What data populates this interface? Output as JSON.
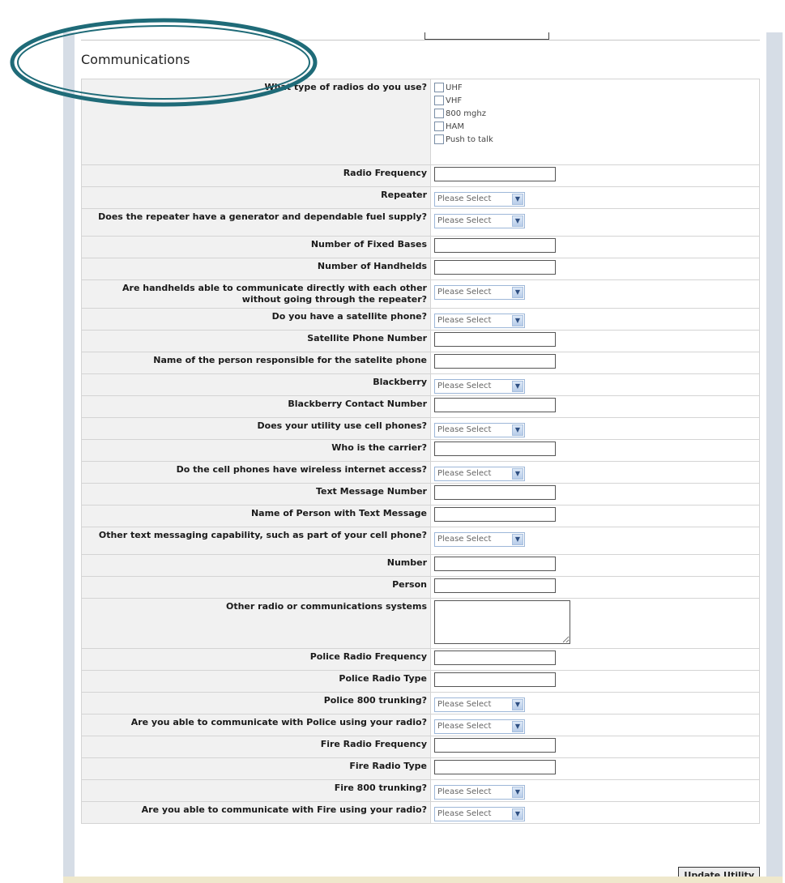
{
  "section": {
    "title": "Communications"
  },
  "rows": [
    {
      "label": "What type of radios do you use?",
      "type": "checkboxes",
      "options": [
        "UHF",
        "VHF",
        "800 mghz",
        "HAM",
        "Push to talk"
      ]
    },
    {
      "label": "Radio Frequency",
      "type": "text",
      "value": ""
    },
    {
      "label": "Repeater",
      "type": "select",
      "value": "Please Select"
    },
    {
      "label": "Does the repeater have a generator and dependable fuel supply?",
      "type": "select",
      "value": "Please Select"
    },
    {
      "label": "Number of Fixed Bases",
      "type": "text",
      "value": ""
    },
    {
      "label": "Number of Handhelds",
      "type": "text",
      "value": ""
    },
    {
      "label": "Are handhelds able to communicate directly with each other without going through the repeater?",
      "type": "select",
      "value": "Please Select"
    },
    {
      "label": "Do you have a satellite phone?",
      "type": "select",
      "value": "Please Select"
    },
    {
      "label": "Satellite Phone Number",
      "type": "text",
      "value": ""
    },
    {
      "label": "Name of the person responsible for the satelite phone",
      "type": "text",
      "value": ""
    },
    {
      "label": "Blackberry",
      "type": "select",
      "value": "Please Select"
    },
    {
      "label": "Blackberry Contact Number",
      "type": "text",
      "value": ""
    },
    {
      "label": "Does your utility use cell phones?",
      "type": "select",
      "value": "Please Select"
    },
    {
      "label": "Who is the carrier?",
      "type": "text",
      "value": ""
    },
    {
      "label": "Do the cell phones have wireless internet access?",
      "type": "select",
      "value": "Please Select"
    },
    {
      "label": "Text Message Number",
      "type": "text",
      "value": ""
    },
    {
      "label": "Name of Person with Text Message",
      "type": "text",
      "value": ""
    },
    {
      "label": "Other text messaging capability, such as part of your cell phone?",
      "type": "select",
      "value": "Please Select"
    },
    {
      "label": "Number",
      "type": "text",
      "value": ""
    },
    {
      "label": "Person",
      "type": "text",
      "value": ""
    },
    {
      "label": "Other radio or communications systems",
      "type": "textarea",
      "value": ""
    },
    {
      "label": "Police Radio Frequency",
      "type": "text",
      "value": ""
    },
    {
      "label": "Police Radio Type",
      "type": "text",
      "value": ""
    },
    {
      "label": "Police 800 trunking?",
      "type": "select",
      "value": "Please Select"
    },
    {
      "label": "Are you able to communicate with Police using your radio?",
      "type": "select",
      "value": "Please Select"
    },
    {
      "label": "Fire Radio Frequency",
      "type": "text",
      "value": ""
    },
    {
      "label": "Fire Radio Type",
      "type": "text",
      "value": ""
    },
    {
      "label": "Fire 800 trunking?",
      "type": "select",
      "value": "Please Select"
    },
    {
      "label": "Are you able to communicate with Fire using your radio?",
      "type": "select",
      "value": "Please Select"
    }
  ],
  "buttons": {
    "update": "Update Utility"
  },
  "icons": {
    "select_arrow": "chevron-down-icon"
  },
  "colors": {
    "highlight_ellipse": "#1f6b78",
    "label_bg": "#f1f1f1"
  }
}
